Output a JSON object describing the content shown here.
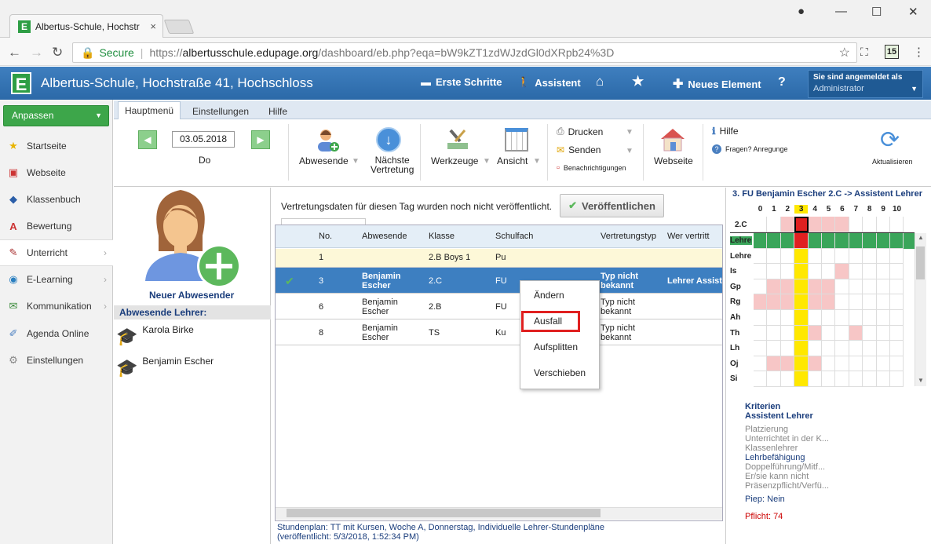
{
  "browser": {
    "tab_title": "Albertus-Schule, Hochstr",
    "tab_close": "×",
    "url_secure": "Secure",
    "url_scheme": "https://",
    "url_domain": "albertusschule.edupage.org",
    "url_rest": "/dashboard/eb.php?eqa=bW9kZT1zdWJzdGl0dXRpb24%3D",
    "ext_badge": "15"
  },
  "header": {
    "logo": "E",
    "title": "Albertus-Schule, Hochstraße 41, Hochschloss",
    "erste_schritte": "Erste Schritte",
    "assistent": "Assistent",
    "neues_element": "Neues Element",
    "help": "?",
    "login_label": "Sie sind angemeldet als",
    "login_user": "Administrator"
  },
  "sidebar": {
    "anpassen": "Anpassen",
    "items": [
      {
        "label": "Startseite",
        "icon": "star-icon"
      },
      {
        "label": "Webseite",
        "icon": "website-icon"
      },
      {
        "label": "Klassenbuch",
        "icon": "book-icon"
      },
      {
        "label": "Bewertung",
        "icon": "grade-icon"
      },
      {
        "label": "Unterricht",
        "icon": "teaching-icon"
      },
      {
        "label": "E-Learning",
        "icon": "globe-icon"
      },
      {
        "label": "Kommunikation",
        "icon": "chat-icon"
      },
      {
        "label": "Agenda Online",
        "icon": "pen-icon"
      },
      {
        "label": "Einstellungen",
        "icon": "settings-icon"
      }
    ]
  },
  "ribbon": {
    "tabs": [
      "Hauptmenü",
      "Einstellungen",
      "Hilfe"
    ],
    "date": "03.05.2018",
    "day": "Do",
    "abwesende": "Abwesende",
    "naechste_1": "Nächste",
    "naechste_2": "Vertretung",
    "werkzeuge": "Werkzeuge",
    "ansicht": "Ansicht",
    "drucken": "Drucken",
    "senden": "Senden",
    "benachrichtigungen": "Benachrichtigungen",
    "webseite": "Webseite",
    "hilfe": "Hilfe",
    "fragen": "Fragen? Anregunge",
    "aktualisieren": "Aktualisieren"
  },
  "left": {
    "neuer_abwesender": "Neuer Abwesender",
    "abwesende_lehrer": "Abwesende Lehrer:",
    "teachers": [
      "Karola Birke",
      "Benjamin Escher"
    ]
  },
  "center": {
    "message": "Vertretungsdaten für diesen Tag wurden noch nicht veröffentlicht.",
    "publish": "Veröffentlichen",
    "columns": [
      "No.",
      "Abwesende",
      "Klasse",
      "Schulfach",
      "Vertretungstyp",
      "Wer vertritt"
    ],
    "rows": [
      {
        "no": "1",
        "abw1": "",
        "abw2": "",
        "klasse": "2.B Boys 1",
        "fach": "Pu",
        "typ1": "",
        "typ2": "",
        "wer": ""
      },
      {
        "no": "3",
        "abw1": "Benjamin",
        "abw2": "Escher",
        "klasse": "2.C",
        "fach": "FU",
        "typ1": "Typ nicht",
        "typ2": "bekannt",
        "wer": "Lehrer Assiste"
      },
      {
        "no": "6",
        "abw1": "Benjamin",
        "abw2": "Escher",
        "klasse": "2.B",
        "fach": "FU",
        "typ1": "Typ nicht",
        "typ2": "bekannt",
        "wer": ""
      },
      {
        "no": "8",
        "abw1": "Benjamin",
        "abw2": "Escher",
        "klasse": "TS",
        "fach": "Ku",
        "typ1": "Typ nicht",
        "typ2": "bekannt",
        "wer": ""
      }
    ],
    "footer1": "Stundenplan: TT mit Kursen, Woche A, Donnerstag, Individuelle Lehrer-Stundenpläne",
    "footer2": "(veröffentlicht: 5/3/2018, 1:52:34 PM)"
  },
  "context_menu": {
    "aendern": "Ändern",
    "ausfall": "Ausfall",
    "aufsplitten": "Aufsplitten",
    "verschieben": "Verschieben"
  },
  "right": {
    "title": "3. FU Benjamin Escher 2.C -> Assistent Lehrer",
    "periods": [
      "0",
      "1",
      "2",
      "3",
      "4",
      "5",
      "6",
      "7",
      "8",
      "9",
      "10"
    ],
    "class_label": "2.C",
    "row_labels": [
      "Lehre",
      "Lehre",
      "Is",
      "Gp",
      "Rg",
      "Ah",
      "Th",
      "Lh",
      "Oj",
      "Si"
    ],
    "kriterien": "Kriterien",
    "assistent_lehrer": "Assistent Lehrer",
    "criteria1": [
      "Platzierung",
      "Unterrichtet in der K...",
      "Klassenlehrer"
    ],
    "lehrbefaehigung": "Lehrbefähigung",
    "criteria2": [
      "Doppelführung/Mitf...",
      "Er/sie kann nicht",
      "Präsenzpflicht/Verfü..."
    ],
    "piep": "Piep: Nein",
    "pflicht": "Pflicht: 74"
  },
  "colors": {
    "accent": "#2b69a8",
    "green": "#3da64a",
    "selected_row": "#3d7fc1"
  }
}
